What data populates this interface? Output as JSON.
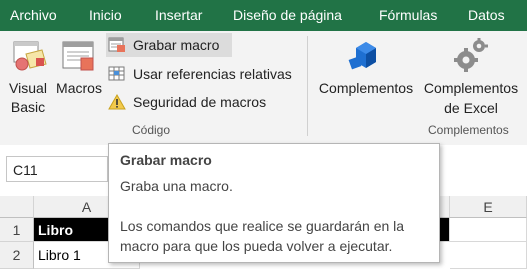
{
  "tabs": [
    "Archivo",
    "Inicio",
    "Insertar",
    "Diseño de página",
    "Fórmulas",
    "Datos"
  ],
  "ribbon": {
    "visual_basic_line1": "Visual",
    "visual_basic_line2": "Basic",
    "macros": "Macros",
    "record_macro": "Grabar macro",
    "relative_refs": "Usar referencias relativas",
    "macro_security": "Seguridad de macros",
    "group_code": "Código",
    "complementos": "Complementos",
    "excel_addins_line1": "Complementos",
    "excel_addins_line2": "de Excel",
    "group_addins": "Complementos"
  },
  "formula_bar": {
    "name_box": "C11"
  },
  "grid": {
    "columns": [
      "A",
      "E"
    ],
    "rows": [
      "1",
      "2"
    ],
    "cells": {
      "A1": "Libro",
      "A2": "Libro 1"
    }
  },
  "tooltip": {
    "title": "Grabar macro",
    "line1": "Graba una macro.",
    "line2": "Los comandos que realice se guardarán en la",
    "line3": "macro para que los pueda volver a ejecutar."
  },
  "colors": {
    "accent_green": "#217346",
    "ribbon_bg": "#f3f3f3",
    "hover": "#dcdcdc",
    "header_bg": "#f0f0f0"
  },
  "icons": [
    "visual-basic-icon",
    "macros-icon",
    "record-macro-icon",
    "relative-references-icon",
    "warning-icon",
    "addins-icon",
    "excel-addins-gear-icon"
  ]
}
